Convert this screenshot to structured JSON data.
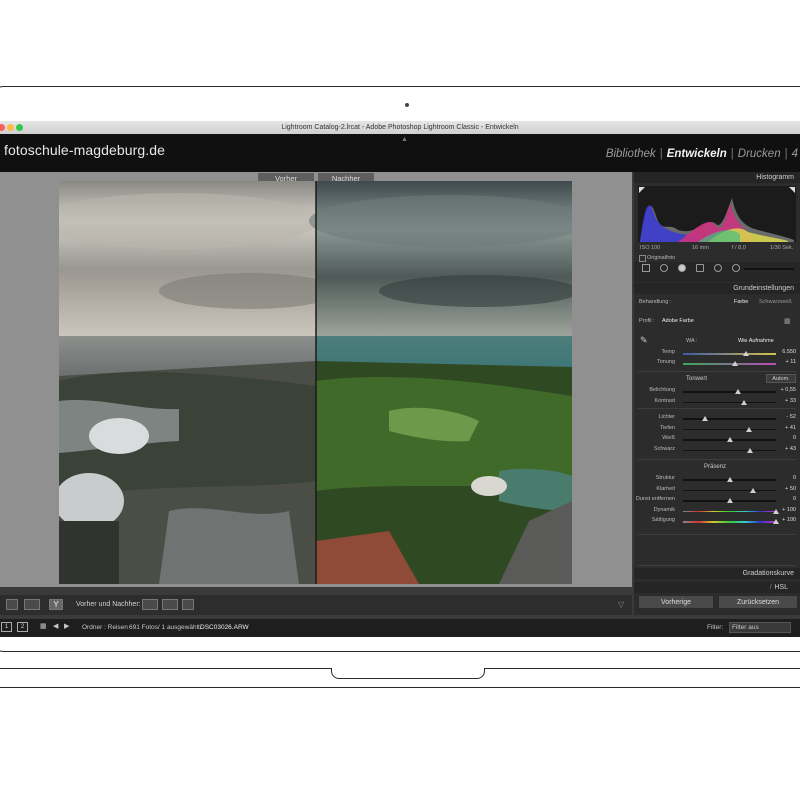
{
  "window": {
    "title": "Lightroom Catalog-2.lrcat - Adobe Photoshop Lightroom Classic - Entwickeln"
  },
  "header": {
    "brand": "fotoschule-magdeburg.de",
    "modules": [
      "Bibliothek",
      "Entwickeln",
      "Drucken",
      "4"
    ],
    "active_module": "Entwickeln"
  },
  "view": {
    "before_label": "Vorher",
    "after_label": "Nachher"
  },
  "toolbar": {
    "before_after_label": "Vorher und Nachher:",
    "y_label": "Y"
  },
  "filmstrip": {
    "page1": "1",
    "page2": "2",
    "path": "Ordner : Reisen",
    "count": "691 Fotos/ 1 ausgewählt/",
    "file": "DSC03026.ARW",
    "filter_label": "Filter:",
    "filter_value": "Filter aus"
  },
  "panel": {
    "histogram_title": "Histogramm",
    "histogram_info": {
      "iso": "ISO 100",
      "focal": "16 mm",
      "aperture": "f / 8,0",
      "shutter": "1/30 Sek."
    },
    "originalfoto": "Originalfoto",
    "basic_title": "Grundeinstellungen",
    "behandlung_label": "Behandlung :",
    "behandlung_farbe": "Farbe",
    "behandlung_sw": "Schwarzweiß",
    "profil_label": "Profil :",
    "profil_value": "Adobe Farbe",
    "wa_label": "WA :",
    "wa_value": "Wie Aufnahme",
    "temp_label": "Temp",
    "temp_value": "6.550",
    "tonung_label": "Tonung",
    "tonung_value": "+ 11",
    "tonwert_title": "Tonwert",
    "autom": "Autom.",
    "sliders_tone": [
      {
        "label": "Belichtung",
        "value": "+ 0,55",
        "pos": 0.59
      },
      {
        "label": "Kontrast",
        "value": "+ 33",
        "pos": 0.66
      }
    ],
    "sliders_light": [
      {
        "label": "Lichter",
        "value": "- 52",
        "pos": 0.24
      },
      {
        "label": "Tiefen",
        "value": "+ 41",
        "pos": 0.71
      },
      {
        "label": "Weiß",
        "value": "0",
        "pos": 0.5
      },
      {
        "label": "Schwarz",
        "value": "+ 43",
        "pos": 0.72
      }
    ],
    "praesenz_title": "Präsenz",
    "sliders_presence": [
      {
        "label": "Struktur",
        "value": "0",
        "pos": 0.5
      },
      {
        "label": "Klarheit",
        "value": "+ 50",
        "pos": 0.75
      },
      {
        "label": "Dunst entfernen",
        "value": "0",
        "pos": 0.5
      },
      {
        "label": "Dynamik",
        "value": "+ 100",
        "pos": 1.0
      },
      {
        "label": "Sättigung",
        "value": "+ 100",
        "pos": 1.0
      }
    ],
    "gradation_title": "Gradationskurve",
    "hsl_title": "HSL",
    "hsl_farbe": "/ Farbe",
    "btn_prev": "Vorherige",
    "btn_reset": "Zurücksetzen"
  },
  "colors": {
    "accent_active": "#f2f2f2",
    "panel_bg": "#2c2c2c",
    "work_bg": "#909090"
  }
}
